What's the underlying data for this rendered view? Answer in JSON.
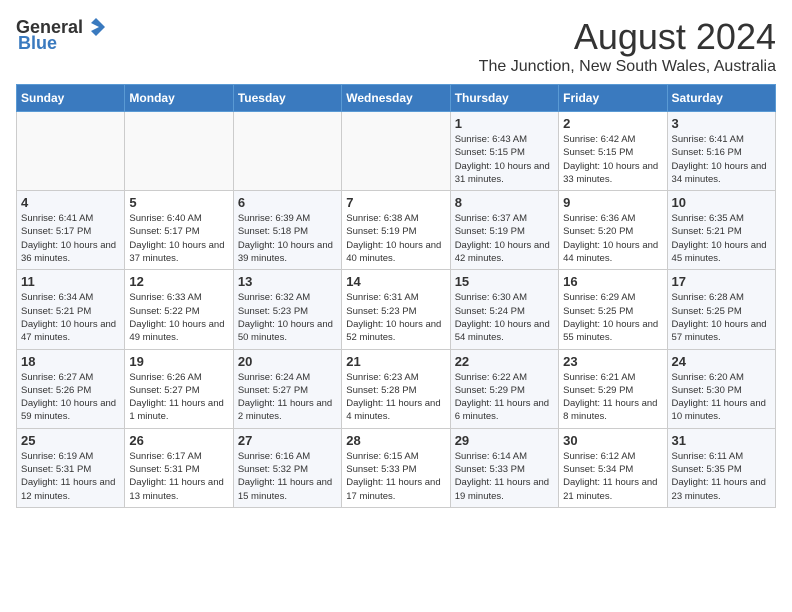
{
  "logo": {
    "general": "General",
    "blue": "Blue"
  },
  "title": "August 2024",
  "subtitle": "The Junction, New South Wales, Australia",
  "days_of_week": [
    "Sunday",
    "Monday",
    "Tuesday",
    "Wednesday",
    "Thursday",
    "Friday",
    "Saturday"
  ],
  "weeks": [
    [
      {
        "day": "",
        "sunrise": "",
        "sunset": "",
        "daylight": ""
      },
      {
        "day": "",
        "sunrise": "",
        "sunset": "",
        "daylight": ""
      },
      {
        "day": "",
        "sunrise": "",
        "sunset": "",
        "daylight": ""
      },
      {
        "day": "",
        "sunrise": "",
        "sunset": "",
        "daylight": ""
      },
      {
        "day": "1",
        "sunrise": "Sunrise: 6:43 AM",
        "sunset": "Sunset: 5:15 PM",
        "daylight": "Daylight: 10 hours and 31 minutes."
      },
      {
        "day": "2",
        "sunrise": "Sunrise: 6:42 AM",
        "sunset": "Sunset: 5:15 PM",
        "daylight": "Daylight: 10 hours and 33 minutes."
      },
      {
        "day": "3",
        "sunrise": "Sunrise: 6:41 AM",
        "sunset": "Sunset: 5:16 PM",
        "daylight": "Daylight: 10 hours and 34 minutes."
      }
    ],
    [
      {
        "day": "4",
        "sunrise": "Sunrise: 6:41 AM",
        "sunset": "Sunset: 5:17 PM",
        "daylight": "Daylight: 10 hours and 36 minutes."
      },
      {
        "day": "5",
        "sunrise": "Sunrise: 6:40 AM",
        "sunset": "Sunset: 5:17 PM",
        "daylight": "Daylight: 10 hours and 37 minutes."
      },
      {
        "day": "6",
        "sunrise": "Sunrise: 6:39 AM",
        "sunset": "Sunset: 5:18 PM",
        "daylight": "Daylight: 10 hours and 39 minutes."
      },
      {
        "day": "7",
        "sunrise": "Sunrise: 6:38 AM",
        "sunset": "Sunset: 5:19 PM",
        "daylight": "Daylight: 10 hours and 40 minutes."
      },
      {
        "day": "8",
        "sunrise": "Sunrise: 6:37 AM",
        "sunset": "Sunset: 5:19 PM",
        "daylight": "Daylight: 10 hours and 42 minutes."
      },
      {
        "day": "9",
        "sunrise": "Sunrise: 6:36 AM",
        "sunset": "Sunset: 5:20 PM",
        "daylight": "Daylight: 10 hours and 44 minutes."
      },
      {
        "day": "10",
        "sunrise": "Sunrise: 6:35 AM",
        "sunset": "Sunset: 5:21 PM",
        "daylight": "Daylight: 10 hours and 45 minutes."
      }
    ],
    [
      {
        "day": "11",
        "sunrise": "Sunrise: 6:34 AM",
        "sunset": "Sunset: 5:21 PM",
        "daylight": "Daylight: 10 hours and 47 minutes."
      },
      {
        "day": "12",
        "sunrise": "Sunrise: 6:33 AM",
        "sunset": "Sunset: 5:22 PM",
        "daylight": "Daylight: 10 hours and 49 minutes."
      },
      {
        "day": "13",
        "sunrise": "Sunrise: 6:32 AM",
        "sunset": "Sunset: 5:23 PM",
        "daylight": "Daylight: 10 hours and 50 minutes."
      },
      {
        "day": "14",
        "sunrise": "Sunrise: 6:31 AM",
        "sunset": "Sunset: 5:23 PM",
        "daylight": "Daylight: 10 hours and 52 minutes."
      },
      {
        "day": "15",
        "sunrise": "Sunrise: 6:30 AM",
        "sunset": "Sunset: 5:24 PM",
        "daylight": "Daylight: 10 hours and 54 minutes."
      },
      {
        "day": "16",
        "sunrise": "Sunrise: 6:29 AM",
        "sunset": "Sunset: 5:25 PM",
        "daylight": "Daylight: 10 hours and 55 minutes."
      },
      {
        "day": "17",
        "sunrise": "Sunrise: 6:28 AM",
        "sunset": "Sunset: 5:25 PM",
        "daylight": "Daylight: 10 hours and 57 minutes."
      }
    ],
    [
      {
        "day": "18",
        "sunrise": "Sunrise: 6:27 AM",
        "sunset": "Sunset: 5:26 PM",
        "daylight": "Daylight: 10 hours and 59 minutes."
      },
      {
        "day": "19",
        "sunrise": "Sunrise: 6:26 AM",
        "sunset": "Sunset: 5:27 PM",
        "daylight": "Daylight: 11 hours and 1 minute."
      },
      {
        "day": "20",
        "sunrise": "Sunrise: 6:24 AM",
        "sunset": "Sunset: 5:27 PM",
        "daylight": "Daylight: 11 hours and 2 minutes."
      },
      {
        "day": "21",
        "sunrise": "Sunrise: 6:23 AM",
        "sunset": "Sunset: 5:28 PM",
        "daylight": "Daylight: 11 hours and 4 minutes."
      },
      {
        "day": "22",
        "sunrise": "Sunrise: 6:22 AM",
        "sunset": "Sunset: 5:29 PM",
        "daylight": "Daylight: 11 hours and 6 minutes."
      },
      {
        "day": "23",
        "sunrise": "Sunrise: 6:21 AM",
        "sunset": "Sunset: 5:29 PM",
        "daylight": "Daylight: 11 hours and 8 minutes."
      },
      {
        "day": "24",
        "sunrise": "Sunrise: 6:20 AM",
        "sunset": "Sunset: 5:30 PM",
        "daylight": "Daylight: 11 hours and 10 minutes."
      }
    ],
    [
      {
        "day": "25",
        "sunrise": "Sunrise: 6:19 AM",
        "sunset": "Sunset: 5:31 PM",
        "daylight": "Daylight: 11 hours and 12 minutes."
      },
      {
        "day": "26",
        "sunrise": "Sunrise: 6:17 AM",
        "sunset": "Sunset: 5:31 PM",
        "daylight": "Daylight: 11 hours and 13 minutes."
      },
      {
        "day": "27",
        "sunrise": "Sunrise: 6:16 AM",
        "sunset": "Sunset: 5:32 PM",
        "daylight": "Daylight: 11 hours and 15 minutes."
      },
      {
        "day": "28",
        "sunrise": "Sunrise: 6:15 AM",
        "sunset": "Sunset: 5:33 PM",
        "daylight": "Daylight: 11 hours and 17 minutes."
      },
      {
        "day": "29",
        "sunrise": "Sunrise: 6:14 AM",
        "sunset": "Sunset: 5:33 PM",
        "daylight": "Daylight: 11 hours and 19 minutes."
      },
      {
        "day": "30",
        "sunrise": "Sunrise: 6:12 AM",
        "sunset": "Sunset: 5:34 PM",
        "daylight": "Daylight: 11 hours and 21 minutes."
      },
      {
        "day": "31",
        "sunrise": "Sunrise: 6:11 AM",
        "sunset": "Sunset: 5:35 PM",
        "daylight": "Daylight: 11 hours and 23 minutes."
      }
    ]
  ]
}
